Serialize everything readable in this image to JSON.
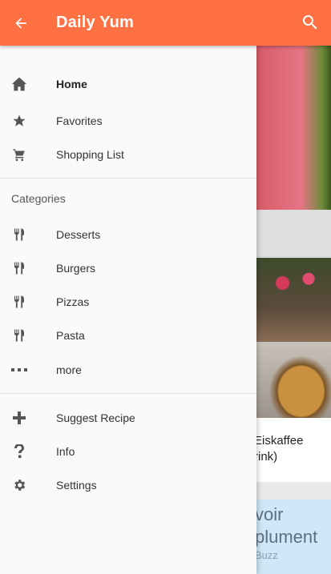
{
  "appbar": {
    "title": "Daily Yum",
    "back_icon": "arrow-back-icon",
    "search_icon": "search-icon",
    "color": "#ff7043"
  },
  "drawer": {
    "primary": [
      {
        "label": "Home",
        "icon": "home-icon",
        "selected": true
      },
      {
        "label": "Favorites",
        "icon": "star-icon"
      },
      {
        "label": "Shopping List",
        "icon": "cart-icon"
      }
    ],
    "categories_header": "Categories",
    "categories": [
      {
        "label": "Desserts",
        "icon": "restaurant-icon"
      },
      {
        "label": "Burgers",
        "icon": "restaurant-icon"
      },
      {
        "label": "Pizzas",
        "icon": "restaurant-icon"
      },
      {
        "label": "Pasta",
        "icon": "restaurant-icon"
      },
      {
        "label": "more",
        "icon": "more-horizontal-icon"
      }
    ],
    "secondary": [
      {
        "label": "Suggest Recipe",
        "icon": "plus-icon"
      },
      {
        "label": "Info",
        "icon": "question-icon"
      },
      {
        "label": "Settings",
        "icon": "gear-icon"
      }
    ]
  },
  "background": {
    "card_caption_line1": "Eiskaffee",
    "card_caption_line2": "rink)",
    "ad_line1": "voir",
    "ad_line2": "plument",
    "ad_line3": "Buzz"
  }
}
